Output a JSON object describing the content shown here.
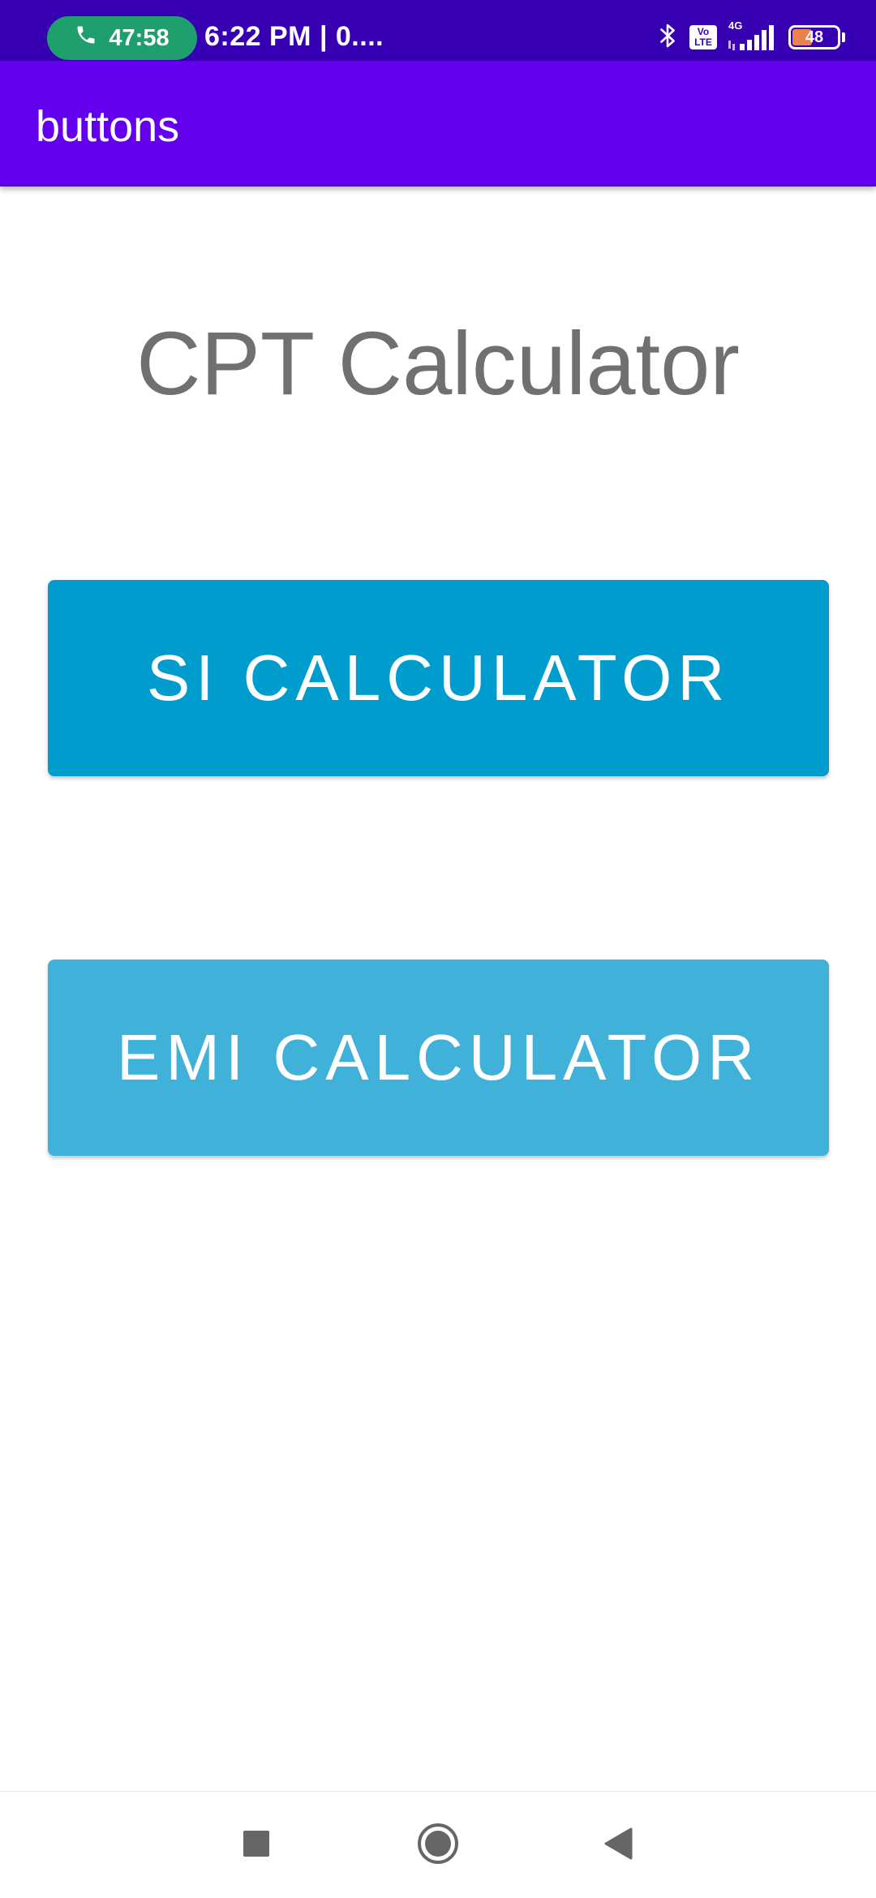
{
  "status_bar": {
    "call_timer": "47:58",
    "time_text": "6:22 PM | 0....",
    "volte_label": "Vo LTE",
    "network_label": "4G",
    "battery_level": "48",
    "battery_percent": 48,
    "icons": [
      "phone-icon",
      "bluetooth-icon",
      "volte-icon",
      "signal-icon",
      "battery-icon"
    ]
  },
  "app_bar": {
    "title": "buttons"
  },
  "main": {
    "heading": "CPT Calculator",
    "si_button_label": "SI CALCULATOR",
    "emi_button_label": "EMI CALCULATOR"
  },
  "nav_bar": {
    "icons": [
      "recents-square-icon",
      "home-circle-icon",
      "back-triangle-icon"
    ]
  },
  "colors": {
    "status_bar": "#3700b3",
    "app_bar": "#6200ee",
    "call_pill": "#1f9e6e",
    "si_button": "#009ccd",
    "emi_button": "#40b1d9",
    "heading_text": "#707070",
    "nav_icons": "#666666"
  }
}
